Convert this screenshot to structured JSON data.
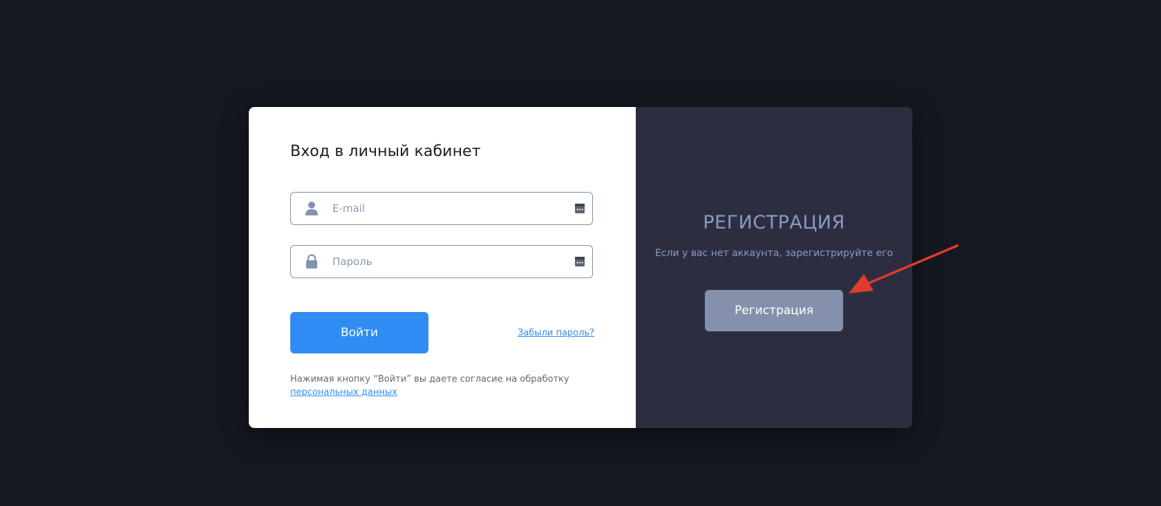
{
  "login": {
    "title": "Вход в личный кабинет",
    "email": {
      "placeholder": "E-mail",
      "value": ""
    },
    "password": {
      "placeholder": "Пароль",
      "value": ""
    },
    "submit_label": "Войти",
    "forgot_label": "Забыли пароль?",
    "consent_text": "Нажимая кнопку “Войти” вы даете согласие на обработку",
    "consent_link": "персональных данных"
  },
  "register": {
    "title": "РЕГИСТРАЦИЯ",
    "subtitle": "Если у вас нет аккаунта, зарегистрируйте его",
    "button_label": "Регистрация"
  },
  "icons": {
    "email_icon": "user-icon",
    "password_icon": "lock-icon",
    "autofill_icon": "keyboard-icon",
    "annotation": "red-arrow"
  },
  "colors": {
    "background": "#161821",
    "primary": "#2f8cf3",
    "register_panel": "#2c2e40",
    "register_button": "#8591ac",
    "register_text": "#8a99bf",
    "annotation_arrow": "#e03a2f"
  }
}
